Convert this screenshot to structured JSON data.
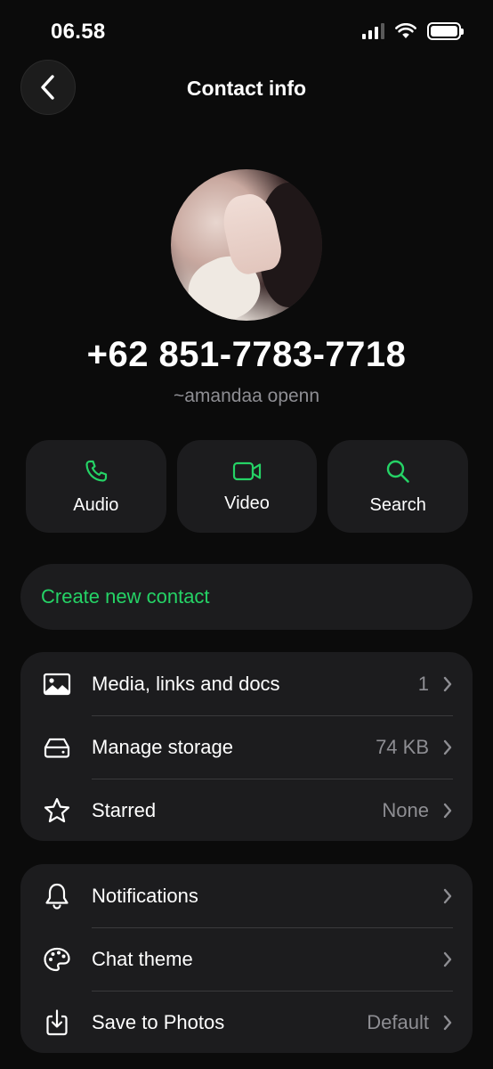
{
  "status_bar": {
    "time": "06.58"
  },
  "header": {
    "title": "Contact info"
  },
  "contact": {
    "phone": "+62 851-7783-7718",
    "name": "~amandaa openn"
  },
  "actions": [
    {
      "label": "Audio",
      "icon": "phone-icon"
    },
    {
      "label": "Video",
      "icon": "video-icon"
    },
    {
      "label": "Search",
      "icon": "search-icon"
    }
  ],
  "create_contact": {
    "label": "Create new contact"
  },
  "group_1": [
    {
      "label": "Media, links and docs",
      "value": "1",
      "icon": "image-icon"
    },
    {
      "label": "Manage storage",
      "value": "74 KB",
      "icon": "storage-icon"
    },
    {
      "label": "Starred",
      "value": "None",
      "icon": "star-icon"
    }
  ],
  "group_2": [
    {
      "label": "Notifications",
      "value": "",
      "icon": "bell-icon"
    },
    {
      "label": "Chat theme",
      "value": "",
      "icon": "palette-icon"
    },
    {
      "label": "Save to Photos",
      "value": "Default",
      "icon": "save-icon"
    }
  ],
  "colors": {
    "accent": "#25d366",
    "background": "#0b0b0b",
    "card": "#1c1c1e",
    "secondary_text": "#8e8e93"
  }
}
